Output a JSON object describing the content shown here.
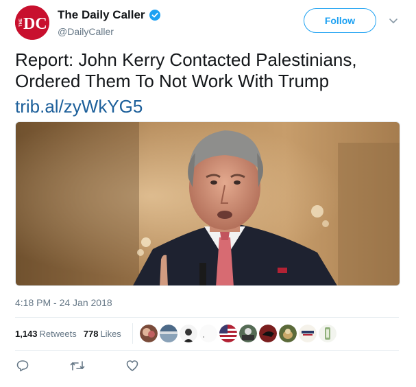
{
  "author": {
    "display_name": "The Daily Caller",
    "handle": "@DailyCaller",
    "avatar_text": "DC",
    "avatar_small_text": "THE",
    "verified": true,
    "brand_color": "#c8102e"
  },
  "follow_button": {
    "label": "Follow",
    "color": "#1da1f2"
  },
  "tweet": {
    "text": "Report: John Kerry Contacted Palestinians, Ordered Them To Not Work With Trump",
    "link": "trib.al/zyWkYG5",
    "timestamp": "4:18 PM - 24 Jan 2018"
  },
  "stats": {
    "retweets_count": "1,143",
    "retweets_label": "Retweets",
    "likes_count": "778",
    "likes_label": "Likes",
    "liker_avatars": 10
  },
  "actions": [
    {
      "name": "reply-icon"
    },
    {
      "name": "retweet-icon"
    },
    {
      "name": "like-icon"
    }
  ],
  "icons": {
    "verified": "verified-badge-icon",
    "caret": "chevron-down-icon"
  }
}
